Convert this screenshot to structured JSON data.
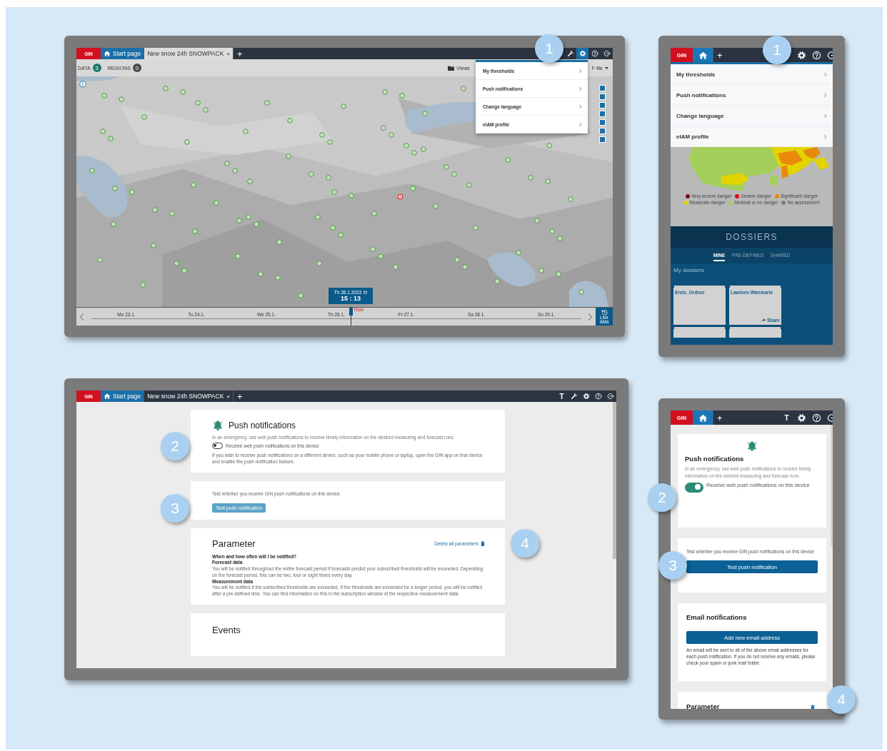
{
  "desktop_map": {
    "tabbar": {
      "logo": "GIN",
      "tabs": [
        {
          "kind": "home",
          "label": "Start page",
          "selected": false
        },
        {
          "kind": "document",
          "label": "New snow 24h SNOWPACK",
          "close": "×",
          "selected": true
        }
      ],
      "add": "+",
      "tools": [
        {
          "kind": "wrench",
          "selected": false
        },
        {
          "kind": "settings",
          "selected": true
        },
        {
          "kind": "help",
          "selected": false
        },
        {
          "kind": "logout",
          "selected": false
        }
      ]
    },
    "toolbar": {
      "filters": [
        {
          "label": "DATA",
          "count": "3",
          "color": "#1f7a6c"
        },
        {
          "label": "REGIONS",
          "count": "0",
          "color": "#4a4a4a"
        }
      ],
      "views": "Views",
      "export": "F file"
    },
    "settings_menu": {
      "items": [
        "My thresholds",
        "Push notifications",
        "Change language",
        "eIAM profile"
      ]
    },
    "timeline": {
      "date": "Th 26.1.2023",
      "time": "15 : 13",
      "now": "Now",
      "days": [
        "Mo 23.1.",
        "Tu 24.1.",
        "We 25.1.",
        "Th 26.1.",
        "Fr 27.1.",
        "Sa 28.1.",
        "Su 29.1."
      ],
      "live": "Live data"
    },
    "callouts": [
      "1"
    ]
  },
  "mobile_menu": {
    "tabbar": {
      "logo": "GIN",
      "tabs": [
        {
          "kind": "home",
          "selected": true
        }
      ],
      "add": "+",
      "tools": [
        {
          "kind": "settings",
          "selected": false
        },
        {
          "kind": "help",
          "selected": false
        },
        {
          "kind": "logout",
          "selected": false
        }
      ]
    },
    "settings_menu": {
      "items": [
        "My thresholds",
        "Push notifications",
        "Change language",
        "eIAM profile"
      ]
    },
    "legend": [
      {
        "label": "Very severe danger",
        "color": "#7a0b0b"
      },
      {
        "label": "Severe danger",
        "color": "#e30613"
      },
      {
        "label": "Significant danger",
        "color": "#e8890c"
      },
      {
        "label": "Moderate danger",
        "color": "#e3d400"
      },
      {
        "label": "Minimal or no danger",
        "color": "#a4cf5a"
      },
      {
        "label": "No assessment",
        "color": "#7d7d7d"
      }
    ],
    "dossiers": {
      "title": "DOSSIERS",
      "tabs": [
        {
          "label": "MINE",
          "selected": true
        },
        {
          "label": "PRE-DEFINED",
          "selected": false
        },
        {
          "label": "SHARED",
          "selected": false
        }
      ],
      "heading": "My dossiers",
      "folders": [
        {
          "name": "Erste_Ordner"
        },
        {
          "name": "Lawinen Warnkarte",
          "share": "Share"
        }
      ]
    },
    "callouts": [
      "1"
    ]
  },
  "desktop_settings": {
    "tabbar": {
      "logo": "GIN",
      "tabs": [
        {
          "kind": "home",
          "label": "Start page",
          "selected": false
        },
        {
          "kind": "document",
          "label": "New snow 24h SNOWPACK",
          "close": "×",
          "selected": false
        }
      ],
      "add": "+",
      "tools": [
        {
          "kind": "text",
          "label": "T",
          "selected": false
        },
        {
          "kind": "wrench",
          "selected": false
        },
        {
          "kind": "settings",
          "selected": false
        },
        {
          "kind": "help",
          "selected": false
        },
        {
          "kind": "logout",
          "selected": false
        }
      ]
    },
    "push": {
      "title": "Push notifications",
      "description": "In an emergency, use web push notifications to receive timely information on the desired measuring and forecast runs.",
      "toggle": {
        "label": "Receive web push notifications on this device",
        "on": false
      },
      "note": "If you wish to receive push notifications on a different device, such as your mobile phone or laptop, open the GIN app on that device and enable the push notification feature."
    },
    "test": {
      "text": "Test whether you receive GIN push notifications on this device",
      "button": "Test push notification"
    },
    "parameter": {
      "title": "Parameter",
      "delete": "Delete all parameters",
      "question": "When and how often will I be notified?",
      "sections": [
        {
          "heading": "Forecast data",
          "text": "You will be notified throughout the entire forecast period if forecasts predict your subscribed thresholds will be exceeded. Depending on the forecast period, this can be two, four or eight times every day."
        },
        {
          "heading": "Measurement data",
          "text": "You will be notified if the subscribed thresholds are exceeded. If the thresholds are exceeded for a longer period, you will be notified after a pre-defined time. You can find information on this in the subscription window of the respective measurement data."
        }
      ]
    },
    "events": {
      "title": "Events"
    },
    "callouts": [
      "2",
      "3",
      "4"
    ]
  },
  "mobile_settings": {
    "tabbar": {
      "logo": "GIN",
      "tabs": [
        {
          "kind": "home",
          "selected": true
        }
      ],
      "add": "+",
      "tools": [
        {
          "kind": "text",
          "label": "T",
          "selected": false
        },
        {
          "kind": "settings",
          "selected": false
        },
        {
          "kind": "help",
          "selected": false
        },
        {
          "kind": "logout",
          "selected": false
        }
      ]
    },
    "push": {
      "title": "Push notifications",
      "description": "In an emergency, use web push notifications to receive timely information on the desired measuring and forecast runs.",
      "toggle": {
        "label": "Receive web push notifications on this device",
        "on": true
      }
    },
    "test": {
      "text": "Test whether you receive GIN push notifications on this device",
      "button": "Test push notification"
    },
    "email": {
      "title": "Email notifications",
      "button": "Add new email address",
      "note": "An email will be sent to all of the above email addresses for each push notification. If you do not receive any emails, please check your spam or junk mail folder."
    },
    "parameter": {
      "title": "Parameter"
    },
    "callouts": [
      "2",
      "3",
      "4"
    ]
  }
}
